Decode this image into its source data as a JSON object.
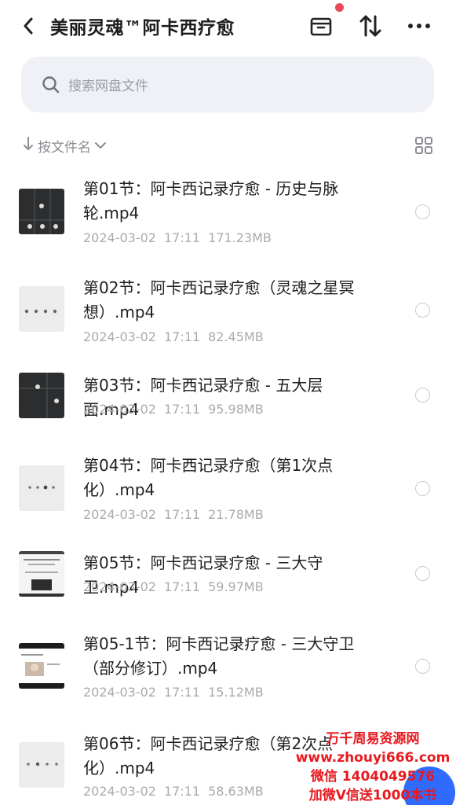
{
  "header": {
    "title": "美丽灵魂™阿卡西疗愈",
    "back_icon": "chevron-left-icon",
    "archive_icon": "archive-box-icon",
    "sort_icon": "sort-arrows-icon",
    "more_icon": "more-horizontal-icon",
    "notify_color": "#e8485a"
  },
  "search": {
    "placeholder": "搜索网盘文件"
  },
  "sort": {
    "label": "按文件名",
    "view_toggle_icon": "grid-view-icon"
  },
  "files": [
    {
      "name": "第01节：阿卡西记录疗愈 - 历史与脉轮.mp4",
      "date": "2024-03-02",
      "time": "17:11",
      "size": "171.23MB",
      "thumb": "dark"
    },
    {
      "name": "第02节：阿卡西记录疗愈（灵魂之星冥想）.mp4",
      "date": "2024-03-02",
      "time": "17:11",
      "size": "82.45MB",
      "thumb": "light"
    },
    {
      "name": "第03节：阿卡西记录疗愈 - 五大层面.mp4",
      "date": "2024-03-02",
      "time": "17:11",
      "size": "95.98MB",
      "thumb": "dark"
    },
    {
      "name": "第04节：阿卡西记录疗愈（第1次点化）.mp4",
      "date": "2024-03-02",
      "time": "17:11",
      "size": "21.78MB",
      "thumb": "light"
    },
    {
      "name": "第05节：阿卡西记录疗愈 - 三大守卫.mp4",
      "date": "2024-03-02",
      "time": "17:11",
      "size": "59.97MB",
      "thumb": "slide"
    },
    {
      "name": "第05-1节：阿卡西记录疗愈 - 三大守卫（部分修订）.mp4",
      "date": "2024-03-02",
      "time": "17:11",
      "size": "15.12MB",
      "thumb": "video"
    },
    {
      "name": "第06节：阿卡西记录疗愈（第2次点化）.mp4",
      "date": "2024-03-02",
      "time": "17:11",
      "size": "58.63MB",
      "thumb": "light"
    }
  ],
  "watermark": {
    "line1": "万千周易资源网",
    "line2": "www.zhouyi666.com",
    "line3": "微信 1404049576",
    "line4": "加微V信送1000本书"
  },
  "colors": {
    "accent": "#2f6bff",
    "watermark": "#e8191f"
  }
}
